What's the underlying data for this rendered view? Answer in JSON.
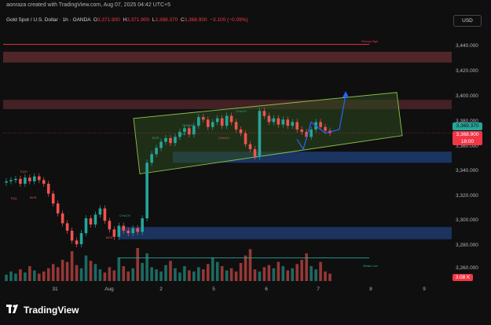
{
  "header": {
    "credit": "aonraza created with TradingView.com, Aug 07, 2025 04:42 UTC+5"
  },
  "legend": {
    "symbol": "Gold Spot / U.S. Dollar · 1h · OANDA",
    "o_label": "O",
    "o_value": "3,371.900",
    "h_label": "H",
    "h_value": "3,371.900",
    "l_label": "L",
    "l_value": "3,368.370",
    "c_label": "C",
    "c_value": "3,368.900",
    "change": "−3.100 (−0.09%)"
  },
  "currency_button": "USD",
  "y_axis": {
    "ticks": [
      "3,440.000",
      "3,420.000",
      "3,400.000",
      "3,380.000",
      "3,360.000",
      "3,340.000",
      "3,320.000",
      "3,300.000",
      "3,280.000",
      "3,260.000"
    ]
  },
  "x_axis": {
    "ticks": [
      "31",
      "Aug",
      "2",
      "5",
      "6",
      "7",
      "8",
      "9"
    ]
  },
  "price_labels": {
    "green_tag": "3,369.370",
    "red_tag": "3,368.900",
    "red_tag_time": "18:00",
    "volume_tag": "3.08 K"
  },
  "annotations": {
    "strong_high": "Strong High",
    "weak_low": "Weak Low",
    "choch_labels": [
      "CHoCH",
      "CHoCH",
      "CHoCH",
      "CHoCH"
    ],
    "bos_labels": [
      "BOS",
      "BOS",
      "BOS",
      "BOS",
      "BOS"
    ],
    "eql": "EQL",
    "eqh": "EQH",
    "bos_left": "BOS"
  },
  "colors": {
    "background": "#0f0f0f",
    "bull": "#26a69a",
    "bear": "#ef5350",
    "channel_fill": "#2e4a1f",
    "channel_stroke": "#8bc34a",
    "supply_zone": "#5a2a2e",
    "demand_zone": "#1d3a6b",
    "projection": "#2962ff",
    "price_tag_green": "#26a69a",
    "price_tag_red": "#f23645"
  },
  "chart_data": {
    "type": "candlestick",
    "title": "Gold Spot / U.S. Dollar · 1h · OANDA",
    "ylim": [
      3250,
      3460
    ],
    "close_path": [
      3330,
      3331,
      3332,
      3328,
      3333,
      3330,
      3334,
      3331,
      3328,
      3320,
      3312,
      3304,
      3296,
      3290,
      3282,
      3279,
      3288,
      3300,
      3295,
      3303,
      3308,
      3298,
      3291,
      3285,
      3294,
      3290,
      3288,
      3292,
      3289,
      3300,
      3345,
      3352,
      3357,
      3362,
      3365,
      3361,
      3366,
      3370,
      3373,
      3368,
      3375,
      3382,
      3380,
      3374,
      3378,
      3381,
      3375,
      3383,
      3378,
      3372,
      3369,
      3360,
      3356,
      3350,
      3387,
      3383,
      3378,
      3381,
      3376,
      3380,
      3375,
      3378,
      3372,
      3370,
      3366,
      3372,
      3378,
      3374,
      3371,
      3369
    ],
    "volume_path": [
      6,
      9,
      7,
      11,
      8,
      14,
      10,
      7,
      9,
      12,
      16,
      13,
      20,
      18,
      28,
      15,
      12,
      24,
      19,
      16,
      11,
      8,
      13,
      10,
      22,
      14,
      9,
      12,
      31,
      17,
      26,
      13,
      11,
      9,
      15,
      19,
      12,
      8,
      14,
      10,
      9,
      13,
      11,
      16,
      22,
      18,
      14,
      10,
      12,
      9,
      17,
      24,
      30,
      11,
      9,
      13,
      15,
      12,
      18,
      14,
      10,
      12,
      16,
      20,
      26,
      14,
      11,
      18,
      9,
      7
    ]
  }
}
